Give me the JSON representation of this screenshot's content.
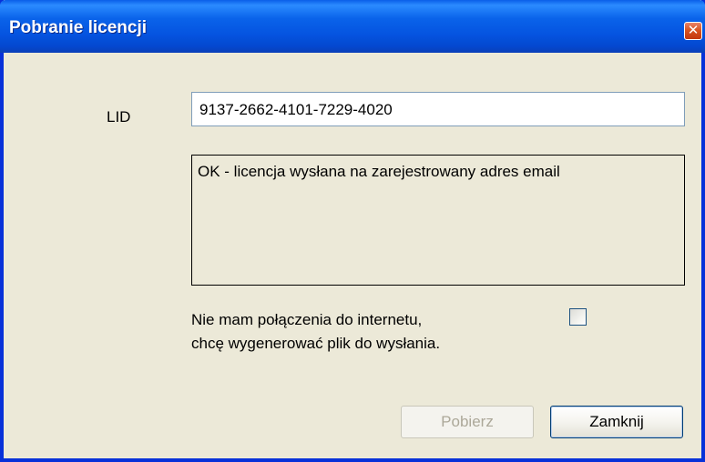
{
  "window": {
    "title": "Pobranie licencji",
    "close_symbol": "✕"
  },
  "form": {
    "lid_label": "LID",
    "lid_value": "9137-2662-4101-7229-4020",
    "status_message": "OK - licencja wysłana na zarejestrowany adres email",
    "offline_line1": "Nie mam połączenia do internetu,",
    "offline_line2": "chcę wygenerować plik do wysłania.",
    "offline_checked": false
  },
  "buttons": {
    "download_label": "Pobierz",
    "download_enabled": false,
    "close_label": "Zamknij"
  },
  "icons": {
    "close": "close-icon"
  },
  "colors": {
    "titlebar": "#0554e0",
    "frame": "#0831d9",
    "dialog_background": "#ece9d8",
    "close_button": "#d9541f",
    "disabled_text": "#aca899"
  }
}
